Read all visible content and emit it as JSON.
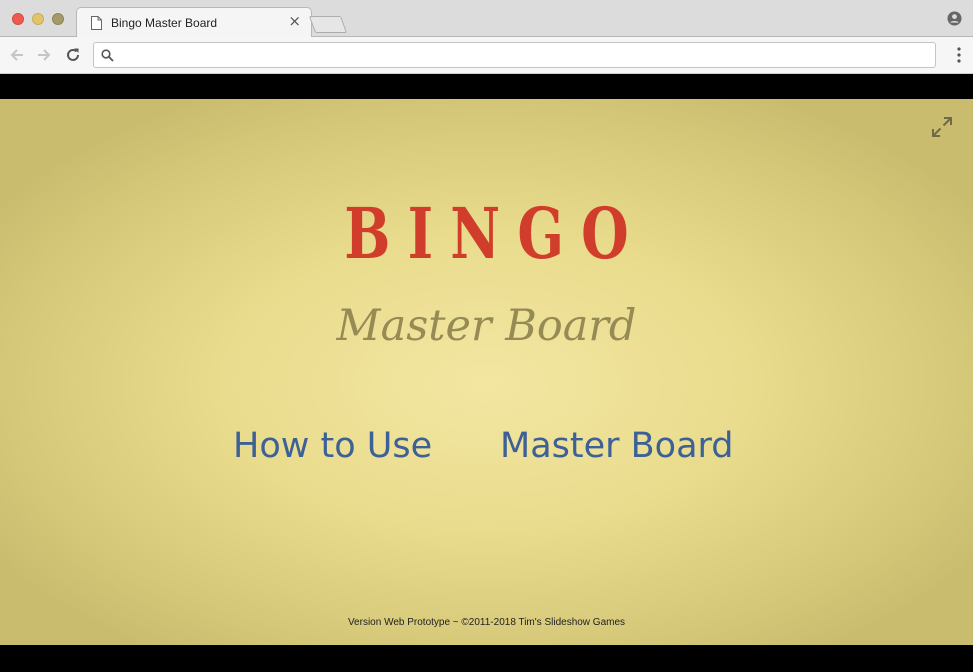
{
  "browser": {
    "tab_title": "Bingo Master Board",
    "close_glyph": "×",
    "address": {
      "value": "",
      "placeholder": ""
    },
    "icons": [
      "page-icon",
      "close-icon",
      "profile-icon",
      "back-icon",
      "forward-icon",
      "reload-icon",
      "search-icon",
      "menu-icon"
    ]
  },
  "page": {
    "title": "BINGO",
    "subtitle": "Master Board",
    "links": [
      {
        "label": "How to Use"
      },
      {
        "label": "Master Board"
      }
    ],
    "footer": "Version Web Prototype ~ ©2011-2018 Tim's Slideshow Games",
    "icons": [
      "fullscreen-icon"
    ]
  },
  "colors": {
    "title": "#d03e2b",
    "subtitle": "#968a55",
    "link": "#3d6196",
    "background_center": "#f3e6a2",
    "background_edge": "#c9bc6e"
  }
}
